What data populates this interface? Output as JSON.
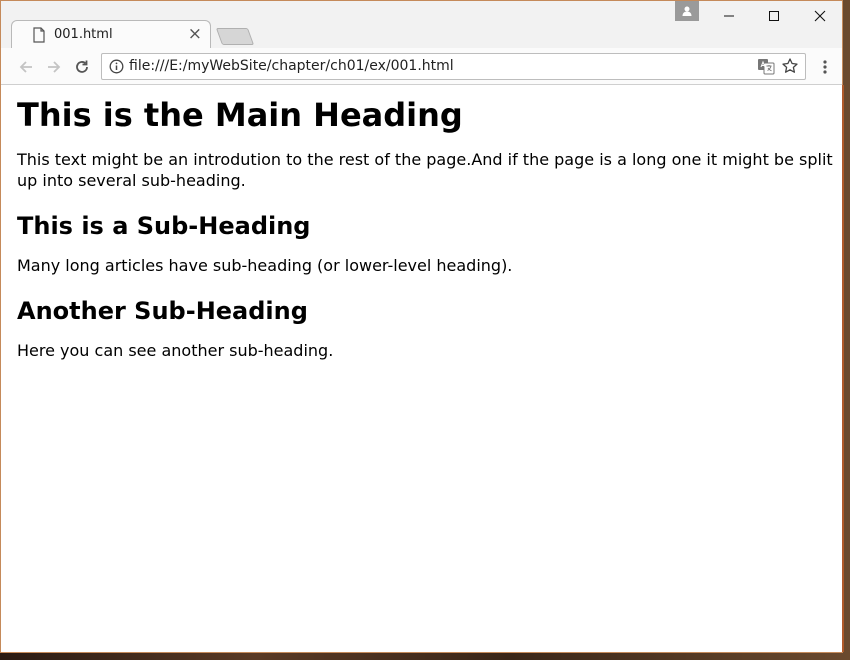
{
  "tab": {
    "title": "001.html",
    "close_label": "×"
  },
  "address_bar": {
    "url": "file:///E:/myWebSite/chapter/ch01/ex/001.html"
  },
  "page": {
    "heading": "This is the Main Heading",
    "intro": "This text might be an introdution to the rest of the page.And if the page is a long one it might be split up into several sub-heading.",
    "sub1": "This is a Sub-Heading",
    "para1": "Many long articles have sub-heading (or lower-level heading).",
    "sub2": "Another Sub-Heading",
    "para2": "Here you can see another sub-heading."
  },
  "icons": [
    "file-icon",
    "profile-icon",
    "minimize-icon",
    "maximize-icon",
    "close-icon",
    "back-icon",
    "forward-icon",
    "reload-icon",
    "info-icon",
    "translate-icon",
    "star-icon",
    "menu-icon"
  ],
  "colors": {
    "window_border": "#c58a5a",
    "chrome_bg": "#f2f2f2",
    "text": "#000000"
  }
}
